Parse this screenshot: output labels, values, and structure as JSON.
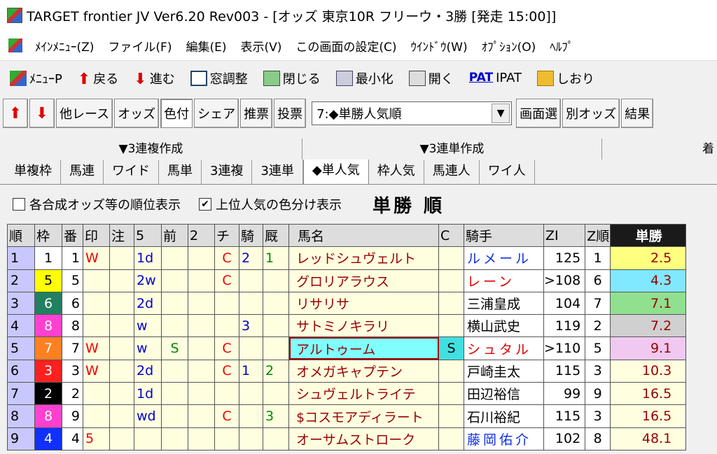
{
  "window": {
    "title": "TARGET frontier JV  Ver6.20  Rev003 - [オッズ 東京10R フリーウ・3勝  [発走 15:00]]"
  },
  "menu": [
    "ﾒｲﾝﾒﾆｭｰ(Z)",
    "ファイル(F)",
    "編集(E)",
    "表示(V)",
    "この画面の設定(C)",
    "ｳｲﾝﾄﾞｳ(W)",
    "ｵﾌﾟｼｮﾝ(O)",
    "ﾍﾙﾌﾟ"
  ],
  "toolbar1": {
    "menu_p": "ﾒﾆｭｰP",
    "back": "戻る",
    "forward": "進む",
    "window_adjust": "窓調整",
    "close": "閉じる",
    "minimize": "最小化",
    "open": "開く",
    "pat": "PAT",
    "ipat": "IPAT",
    "bookmark": "しおり"
  },
  "toolbar2": {
    "other_race": "他レース",
    "odds": "オッズ",
    "color": "色付",
    "share": "シェア",
    "recommend": "推票",
    "vote": "投票",
    "combo_value": "7:◆単勝人気順",
    "screen_select": "画面選",
    "other_odds": "別オッズ",
    "result": "結果"
  },
  "tab_groups": [
    "▼3連複作成",
    "▼3連単作成",
    "着"
  ],
  "tabs": [
    "単複枠",
    "馬連",
    "ワイド",
    "馬単",
    "3連複",
    "3連単",
    "◆単人気",
    "枠人気",
    "馬連人",
    "ワイ人"
  ],
  "active_tab": "◆単人気",
  "options": {
    "rank_display": "各合成オッズ等の順位表示",
    "rank_checked": false,
    "color_display": "上位人気の色分け表示",
    "color_checked": true,
    "heading": "単勝 順"
  },
  "columns": [
    "順",
    "枠",
    "番",
    "印",
    "注",
    "5",
    "前",
    "2",
    "チ",
    "騎",
    "厩",
    "馬名",
    "C",
    "騎手",
    "ZI",
    "Z順",
    "単勝"
  ],
  "rows": [
    {
      "jun": "1",
      "waku": "1",
      "ban": "1",
      "in": "W",
      "chu": "",
      "f5": "1d",
      "mae": "",
      "n2": "",
      "chi": "C",
      "ki": "2",
      "kyu": "1",
      "horse": "レッドシュヴェルト",
      "c": "",
      "jockey": "ルメール",
      "zi": "125",
      "zj": "1",
      "odds": "2.5"
    },
    {
      "jun": "2",
      "waku": "5",
      "ban": "5",
      "in": "",
      "chu": "",
      "f5": "2w",
      "mae": "",
      "n2": "",
      "chi": "C",
      "ki": "",
      "kyu": "",
      "horse": "グロリアラウス",
      "c": "",
      "jockey": "レーン",
      "zi": ">108",
      "zj": "6",
      "odds": "4.3"
    },
    {
      "jun": "3",
      "waku": "6",
      "ban": "6",
      "in": "",
      "chu": "",
      "f5": "2d",
      "mae": "",
      "n2": "",
      "chi": "",
      "ki": "",
      "kyu": "",
      "horse": "リサリサ",
      "c": "",
      "jockey": "三浦皇成",
      "zi": "104",
      "zj": "7",
      "odds": "7.1"
    },
    {
      "jun": "4",
      "waku": "8",
      "ban": "8",
      "in": "",
      "chu": "",
      "f5": "w",
      "mae": "",
      "n2": "",
      "chi": "",
      "ki": "3",
      "kyu": "",
      "horse": "サトミノキラリ",
      "c": "",
      "jockey": "横山武史",
      "zi": "119",
      "zj": "2",
      "odds": "7.2"
    },
    {
      "jun": "5",
      "waku": "7",
      "ban": "7",
      "in": "W",
      "chu": "",
      "f5": "w",
      "mae": "S",
      "n2": "",
      "chi": "C",
      "ki": "",
      "kyu": "",
      "horse": "アルトゥーム",
      "c": "S",
      "jockey": "シュタル",
      "zi": ">110",
      "zj": "5",
      "odds": "9.1"
    },
    {
      "jun": "6",
      "waku": "3",
      "ban": "3",
      "in": "W",
      "chu": "",
      "f5": "2d",
      "mae": "",
      "n2": "",
      "chi": "C",
      "ki": "1",
      "kyu": "2",
      "horse": "オメガキャプテン",
      "c": "",
      "jockey": "戸崎圭太",
      "zi": "115",
      "zj": "3",
      "odds": "10.3"
    },
    {
      "jun": "7",
      "waku": "2",
      "ban": "2",
      "in": "",
      "chu": "",
      "f5": "1d",
      "mae": "",
      "n2": "",
      "chi": "",
      "ki": "",
      "kyu": "",
      "horse": "シュヴェルトライテ",
      "c": "",
      "jockey": "田辺裕信",
      "zi": "99",
      "zj": "9",
      "odds": "16.5"
    },
    {
      "jun": "8",
      "waku": "8",
      "ban": "9",
      "in": "",
      "chu": "",
      "f5": "wd",
      "mae": "",
      "n2": "",
      "chi": "C",
      "ki": "",
      "kyu": "3",
      "horse": "$コスモアディラート",
      "c": "",
      "jockey": "石川裕紀",
      "zi": "115",
      "zj": "3",
      "odds": "16.5"
    },
    {
      "jun": "9",
      "waku": "4",
      "ban": "4",
      "in": "5",
      "chu": "",
      "f5": "",
      "mae": "",
      "n2": "",
      "chi": "",
      "ki": "",
      "kyu": "",
      "horse": "オーサムストローク",
      "c": "",
      "jockey": "藤岡佑介",
      "zi": "102",
      "zj": "8",
      "odds": "48.1"
    }
  ],
  "colors": {
    "waku": {
      "1": "#ffffff",
      "2": "#000000",
      "3": "#ff2020",
      "4": "#1030ff",
      "5": "#ffff00",
      "6": "#208060",
      "7": "#ff8020",
      "8": "#ff40d0"
    },
    "jockey_blue": "#1030e0",
    "jockey_red": "#e00000",
    "rank1_bg": "#ffff00",
    "rank2_bg": "#40ffff",
    "rank3_bg": "#20e020",
    "odds_row_colors": [
      "#ffff80",
      "#80e8ff",
      "#90e090",
      "#d0d0d0",
      "#f0c8f0",
      "#ffffe0",
      "#ffffe0",
      "#ffffe0",
      "#ffffe0"
    ]
  }
}
